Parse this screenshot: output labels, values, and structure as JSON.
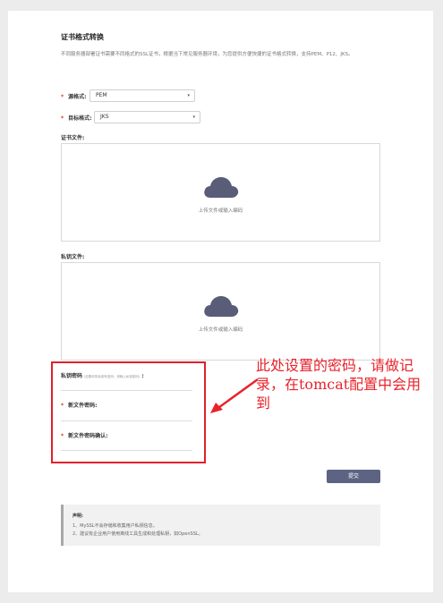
{
  "page": {
    "title": "证书格式转换",
    "description": "不同服务器部署证书需要不同格式的SSL证书，根据当下常见服务器环境，为您提供方便快捷的证书格式转换，支持PEM、P12、JKS。"
  },
  "form": {
    "source_format": {
      "label": "源格式:",
      "value": "PEM"
    },
    "target_format": {
      "label": "目标格式:",
      "value": "JKS"
    },
    "cert_file": {
      "label": "证书文件:",
      "upload_text": "上传文件或输入编码"
    },
    "key_file": {
      "label": "私钥文件:",
      "upload_text": "上传文件或输入编码"
    },
    "key_password": {
      "label": "私钥密码",
      "hint": "(如果你的私钥有密码，请输入私钥密码)",
      "colon": ":"
    },
    "new_password": {
      "label": "新文件密码:"
    },
    "new_password_confirm": {
      "label": "新文件密码确认:"
    },
    "required_mark": "*",
    "submit_label": "提交"
  },
  "notice": {
    "title": "声明:",
    "items": [
      "1、MySSL不会存储和收集用户私钥信息。",
      "2、建议有企业用户使用离线工具生成和处理私钥，如OpenSSL。"
    ]
  },
  "annotation": {
    "text": "此处设置的密码，请做记录，在tomcat配置中会用到",
    "color": "#e8232b"
  },
  "icons": {
    "select_caret": "▾",
    "cloud": "cloud-upload-icon"
  },
  "colors": {
    "accent": "#5c6383",
    "required": "#e0311c",
    "highlight": "#e0202a"
  }
}
